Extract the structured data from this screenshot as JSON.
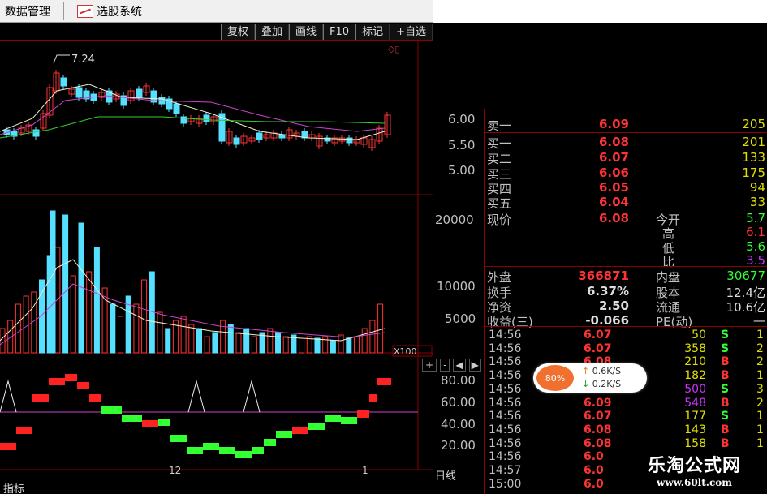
{
  "menu": {
    "data_manage": "数据管理",
    "stock_select": "选股系统"
  },
  "toolbar": {
    "buttons": [
      "复权",
      "叠加",
      "画线",
      "F10",
      "标记",
      "+自选"
    ]
  },
  "chart": {
    "high_label": "7.24",
    "price_axis": [
      "6.00",
      "5.50",
      "5.00"
    ],
    "vol_axis": [
      "20000",
      "10000",
      "5000"
    ],
    "vol_unit": "X100",
    "ind_axis": [
      "80.00",
      "60.00",
      "40.00",
      "20.00"
    ],
    "nav": [
      "+",
      "-",
      "◀",
      "▶"
    ],
    "x_labels": [
      "12",
      "1"
    ],
    "period": "日线",
    "indicator_tab": "指标"
  },
  "book": {
    "sell": [
      {
        "label": "卖一",
        "price": "6.09",
        "vol": "205"
      }
    ],
    "buy": [
      {
        "label": "买一",
        "price": "6.08",
        "vol": "201"
      },
      {
        "label": "买二",
        "price": "6.07",
        "vol": "133"
      },
      {
        "label": "买三",
        "price": "6.06",
        "vol": "175"
      },
      {
        "label": "买四",
        "price": "6.05",
        "vol": "94"
      },
      {
        "label": "买五",
        "price": "6.04",
        "vol": "33"
      }
    ],
    "now_label": "现价",
    "now_price": "6.08",
    "open_label": "今开",
    "open": "5.7",
    "high_label": "高",
    "high": "6.1",
    "low_label": "低",
    "low": "5.6",
    "ratio_label": "比",
    "ratio": "3.5",
    "outer_label": "外盘",
    "outer": "366871",
    "inner_label": "内盘",
    "inner": "30677",
    "turnover_label": "换手",
    "turnover": "6.37%",
    "capital_label": "股本",
    "capital": "12.4亿",
    "nav_label": "净资",
    "nav": "2.50",
    "float_label": "流通",
    "float": "10.6亿",
    "eps_label": "收益(三)",
    "eps": "-0.066",
    "pe_label": "PE(动)",
    "pe": "—"
  },
  "trades": [
    {
      "time": "14:56",
      "price": "6.07",
      "vol": "50",
      "side": "S",
      "n": "1"
    },
    {
      "time": "14:56",
      "price": "6.07",
      "vol": "358",
      "side": "S",
      "n": "2"
    },
    {
      "time": "14:56",
      "price": "6.08",
      "vol": "210",
      "side": "B",
      "n": "2"
    },
    {
      "time": "14:56",
      "price": "6.08",
      "vol": "182",
      "side": "B",
      "n": "1"
    },
    {
      "time": "14:56",
      "price": "6.09",
      "vol": "500",
      "side": "S",
      "n": "3"
    },
    {
      "time": "14:56",
      "price": "6.09",
      "vol": "548",
      "side": "B",
      "n": "2"
    },
    {
      "time": "14:56",
      "price": "6.07",
      "vol": "177",
      "side": "S",
      "n": "1"
    },
    {
      "time": "14:56",
      "price": "6.08",
      "vol": "143",
      "side": "B",
      "n": "1"
    },
    {
      "time": "14:56",
      "price": "6.08",
      "vol": "158",
      "side": "B",
      "n": "1"
    },
    {
      "time": "14:56",
      "price": "6.0",
      "vol": "",
      "side": "",
      "n": ""
    },
    {
      "time": "14:57",
      "price": "6.0",
      "vol": "",
      "side": "",
      "n": ""
    },
    {
      "time": "15:00",
      "price": "6.0",
      "vol": "",
      "side": "",
      "n": ""
    }
  ],
  "widget": {
    "percent": "80%",
    "up_speed": "0.6K/S",
    "down_speed": "0.2K/S"
  },
  "watermark": {
    "title": "乐淘公式网",
    "url": "www.60lt.com"
  },
  "colors": {
    "up": "#ff3333",
    "down": "#55e0ff",
    "green": "#33ff33",
    "grid": "#8b0000"
  }
}
